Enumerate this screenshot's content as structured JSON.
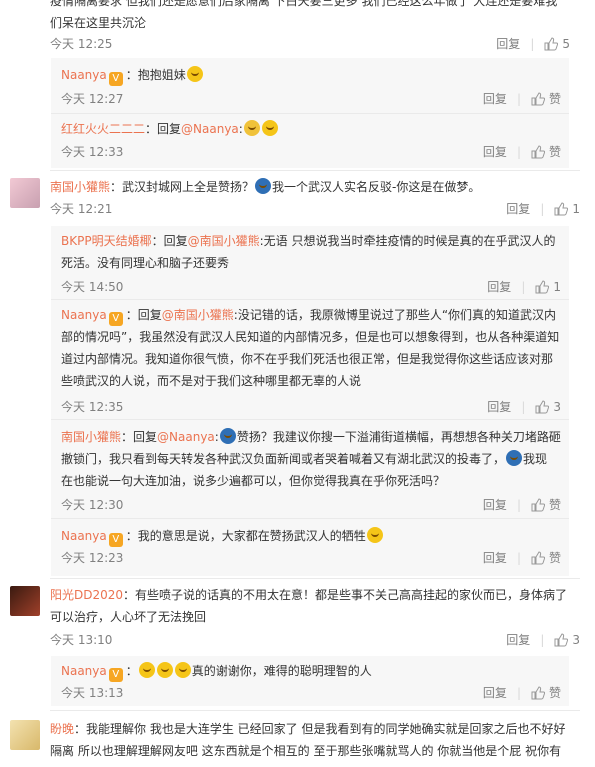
{
  "top": {
    "text_line1": "疫情隔离要求 但我们还是愿意们后家隔离 下白天要三更多 我们已经这么年做了 大连还是要难我",
    "text_line2": "们呆在这里共沉沦",
    "time": "今天 12:25",
    "reply_label": "回复",
    "like_count": "5"
  },
  "replies_a": [
    {
      "name": "Naanya",
      "text": "抱抱姐妹",
      "time": "今天 12:27",
      "reply_label": "回复",
      "like_label": "赞"
    },
    {
      "name": "红红火火二二二",
      "prefix": "：回复",
      "mention": "@Naanya",
      "text": ":",
      "time": "今天 12:33",
      "reply_label": "回复",
      "like_label": "赞"
    }
  ],
  "comment2": {
    "name": "南国小獾熊",
    "text": "：武汉封城网上全是赞扬？",
    "text2": "我一个武汉人实名反驳-你这是在做梦。",
    "time": "今天 12:21",
    "reply_label": "回复",
    "like_count": "1"
  },
  "replies_b": [
    {
      "name": "BKPP明天结婚椰",
      "prefix": "：回复",
      "mention": "@南国小獾熊",
      "text": ":无语 只想说我当时牵挂疫情的时候是真的在乎武汉人的",
      "text_l2": "死活。没有同理心和脑子还要秀",
      "time": "今天 14:50",
      "reply_label": "回复",
      "like_count": "1"
    },
    {
      "name": "Naanya",
      "prefix": "：回复",
      "mention": "@南国小獾熊",
      "text": ":没记错的话，我原微博里说过了那些人“你们真的知道武汉内",
      "text_l2": "部的情况吗”，我虽然没有武汉人民知道的内部情况多，但是也可以想象得到，也从各种渠道知",
      "text_l3": "道过内部情况。我知道你很气愤，你不在乎我们死活也很正常，但是我觉得你这些话应该对那",
      "text_l4": "些喷武汉的人说，而不是对于我们这种哪里都无辜的人说",
      "time": "今天 12:35",
      "reply_label": "回复",
      "like_count": "3"
    },
    {
      "name": "南国小獾熊",
      "prefix": "：回复",
      "mention": "@Naanya",
      "text": ":",
      "text_a": "赞扬？我建议你搜一下溢浦街道横幅，再想想各种关刀堵路砸",
      "text_l2": "撤锁门，我只看到每天转发各种武汉负面新闻或者哭着喊着又有湖北武汉的投毒了，",
      "text_l2b": "我现",
      "text_l3": "在也能说一句大连加油，说多少遍都可以，但你觉得我真在乎你死活吗？",
      "time": "今天 12:30",
      "reply_label": "回复",
      "like_label": "赞"
    },
    {
      "name": "Naanya",
      "text": "：我的意思是说，大家都在赞扬武汉人的牺牲",
      "time": "今天 12:23",
      "reply_label": "回复",
      "like_label": "赞"
    }
  ],
  "comment3": {
    "name": "阳光DD2020",
    "text": "：有些喷子说的话真的不用太在意！都是些事不关己高高挂起的家伙而已，身体病了",
    "text_l2": "可以治疗，人心坏了无法挽回",
    "time": "今天 13:10",
    "reply_label": "回复",
    "like_count": "3"
  },
  "replies_c": [
    {
      "name": "Naanya",
      "text": "真的谢谢你，难得的聪明理智的人",
      "time": "今天 13:13",
      "reply_label": "回复",
      "like_label": "赞"
    }
  ],
  "comment4": {
    "name": "盼晚",
    "text": "：我能理解你 我也是大连学生 已经回家了 但是我看到有的同学她确实就是回家之后也不好好",
    "text_l2": "隔离 所以也理解理解网友吧 这东西就是个相互的 至于那些张嘴就骂人的 你就当他是个屁 祝你有"
  }
}
